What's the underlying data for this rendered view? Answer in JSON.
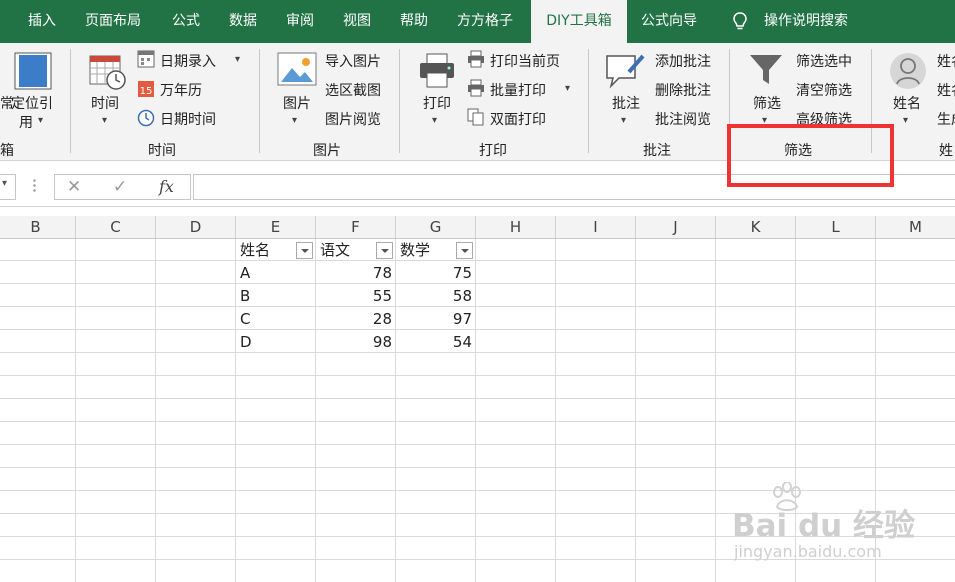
{
  "tabs": [
    "插入",
    "页面布局",
    "公式",
    "数据",
    "审阅",
    "视图",
    "帮助",
    "方方格子",
    "DIY工具箱",
    "公式向导",
    "操作说明搜索"
  ],
  "active_tab": "DIY工具箱",
  "ribbon": {
    "edge": {
      "text1": "常",
      "text2": "箱"
    },
    "locate": {
      "line1": "定位引",
      "line2": "用"
    },
    "time_group": {
      "big": "时间",
      "items": [
        "日期录入",
        "万年历",
        "日期时间"
      ],
      "label": "时间",
      "calendar_number": "15"
    },
    "picture_group": {
      "big": "图片",
      "items": [
        "导入图片",
        "选区截图",
        "图片阅览"
      ],
      "label": "图片"
    },
    "print_group": {
      "big": "打印",
      "items": [
        "打印当前页",
        "批量打印",
        "双面打印"
      ],
      "label": "打印"
    },
    "comment_group": {
      "big": "批注",
      "items": [
        "添加批注",
        "删除批注",
        "批注阅览"
      ],
      "label": "批注"
    },
    "filter_group": {
      "big": "筛选",
      "items": [
        "筛选选中",
        "清空筛选",
        "高级筛选"
      ],
      "label": "筛选"
    },
    "name_group": {
      "big": "姓名",
      "items": [
        "姓名",
        "姓名",
        "生成"
      ],
      "label": "姓"
    }
  },
  "formula_bar": {
    "cancel": "✕",
    "confirm": "✓",
    "fx": "fx",
    "value": ""
  },
  "columns": [
    "B",
    "C",
    "D",
    "E",
    "F",
    "G",
    "H",
    "I",
    "J",
    "K",
    "L",
    "M"
  ],
  "table": {
    "headers": [
      "姓名",
      "语文",
      "数学"
    ],
    "rows": [
      [
        "A",
        "78",
        "75"
      ],
      [
        "B",
        "55",
        "58"
      ],
      [
        "C",
        "28",
        "97"
      ],
      [
        "D",
        "98",
        "54"
      ]
    ]
  },
  "watermark": {
    "brand": "Bai du 经验",
    "url": "jingyan.baidu.com"
  },
  "colors": {
    "ribbon_green": "#217346",
    "highlight_red": "#ee3333"
  }
}
